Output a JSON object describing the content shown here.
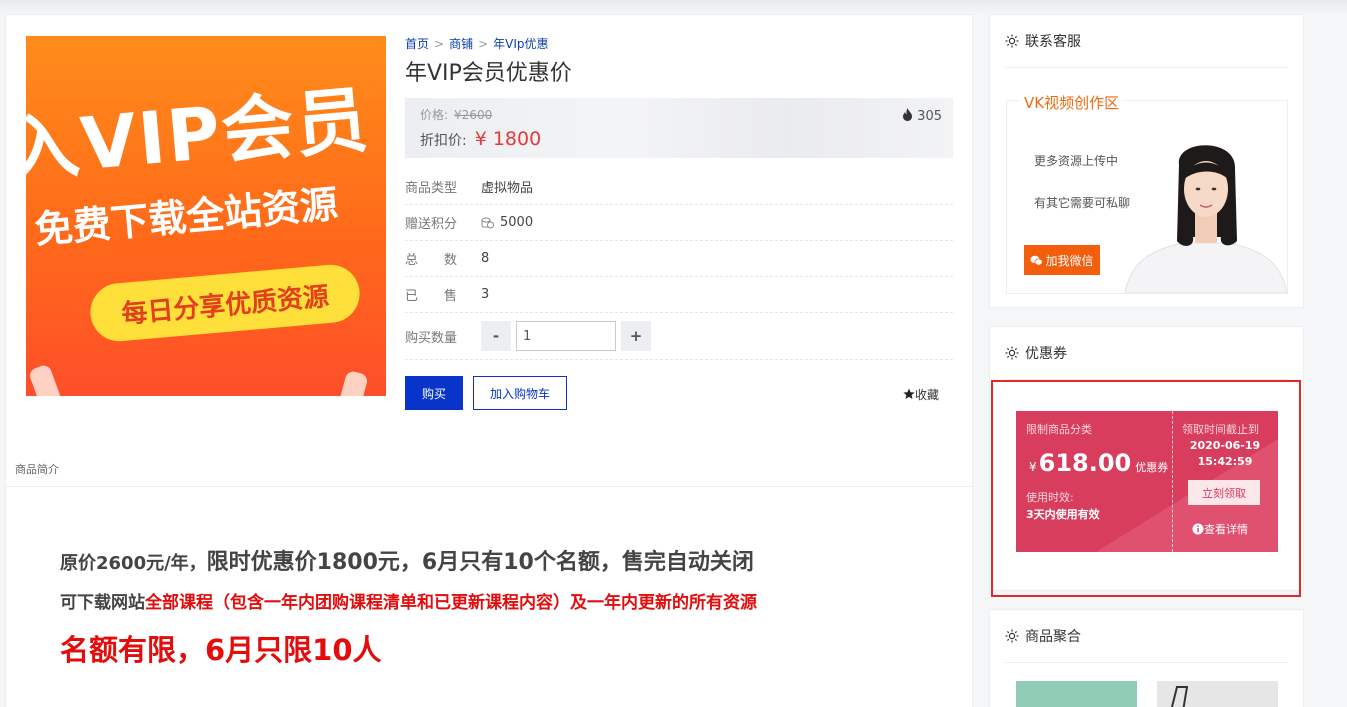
{
  "product": {
    "image_text": {
      "line1": "入VIP会员",
      "line2": "免费下载全站资源",
      "pill": "每日分享优质资源"
    },
    "breadcrumb": [
      "首页",
      "商铺",
      "年VIp优惠"
    ],
    "title": "年VIP会员优惠价",
    "price_label": "价格:",
    "original_price": "¥2600",
    "discount_label": "折扣价:",
    "discount_price": "¥ 1800",
    "views": "305",
    "rows": [
      {
        "label": "商品类型",
        "value": "虚拟物品"
      },
      {
        "label": "赠送积分",
        "value": "5000"
      },
      {
        "label": "总　　数",
        "value": "8"
      },
      {
        "label": "已　　售",
        "value": "3"
      }
    ],
    "qty_label": "购买数量",
    "qty_minus": "-",
    "qty_value": "1",
    "qty_plus": "+",
    "buy_label": "购买",
    "cart_label": "加入购物车",
    "fav_label": "收藏"
  },
  "intro": {
    "tab_label": "商品简介",
    "line1_small": "原价2600元/年，",
    "line1_big": "限时优惠价1800元，6月只有10个名额，售完自动关闭",
    "line2_prefix": "可下载网站",
    "line2_red": "全部课程（包含一年内团购课程清单和已更新课程内容）及一年内更新的所有资源",
    "line3": "名额有限，6月只限10人"
  },
  "sidebar": {
    "contact": {
      "title": "联系客服",
      "box_label": "VK视频创作区",
      "text1": "更多资源上传中",
      "text2": "有其它需要可私聊",
      "button": "加我微信"
    },
    "coupon": {
      "title": "优惠券",
      "category": "限制商品分类",
      "currency": "¥",
      "amount": "618.00",
      "unit": "优惠券",
      "use_label": "使用时效:",
      "use_value": "3天内使用有效",
      "until_label": "领取时间截止到",
      "until_date": "2020-06-19",
      "until_time": "15:42:59",
      "claim_button": "立刻领取",
      "detail_link": "查看详情"
    },
    "aggregate": {
      "title": "商品聚合"
    }
  },
  "colors": {
    "primary_blue": "#0834c9",
    "price_red": "#e4393c",
    "coupon_red": "#d93d5e",
    "wechat_orange": "#f35e0c",
    "highlight_red": "#e3282a"
  }
}
